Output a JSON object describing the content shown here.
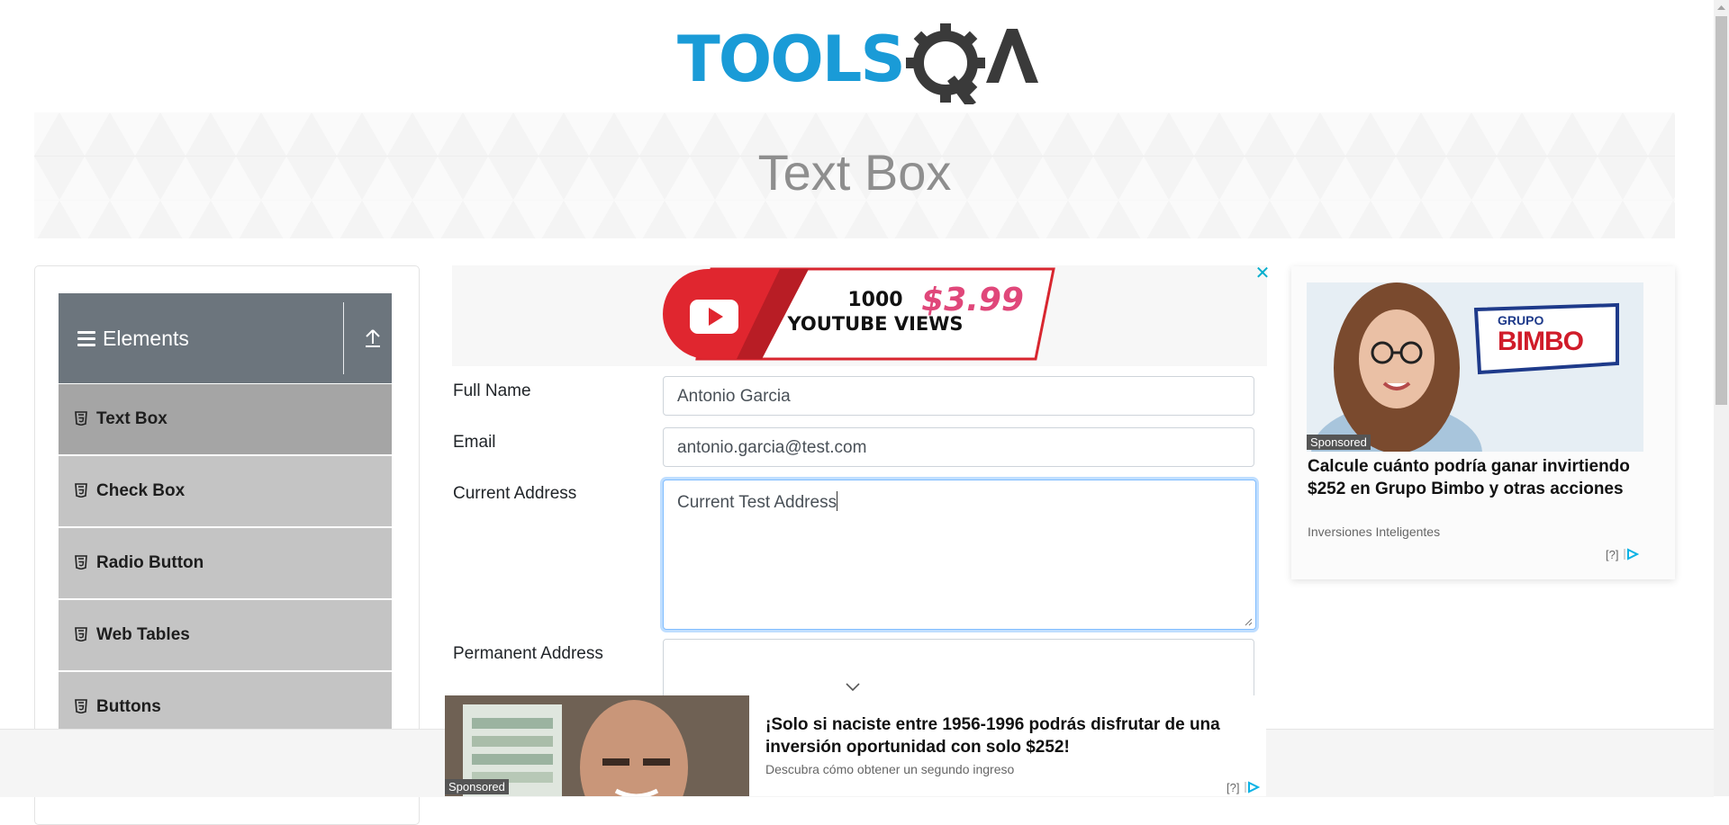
{
  "header": {
    "logo_text": "TOOLSQA",
    "brand_colors": {
      "tools": "#1a9bd7",
      "qa": "#3a3a3a"
    }
  },
  "banner": {
    "title": "Text Box"
  },
  "sidebar": {
    "group_title": "Elements",
    "items": [
      {
        "label": "Text Box",
        "active": true
      },
      {
        "label": "Check Box",
        "active": false
      },
      {
        "label": "Radio Button",
        "active": false
      },
      {
        "label": "Web Tables",
        "active": false
      },
      {
        "label": "Buttons",
        "active": false
      }
    ]
  },
  "top_ad": {
    "line1": "1000",
    "line2": "YOUTUBE VIEWS",
    "price": "$3.99",
    "close_label": "✕"
  },
  "form": {
    "full_name": {
      "label": "Full Name",
      "value": "Antonio Garcia"
    },
    "email": {
      "label": "Email",
      "value": "antonio.garcia@test.com"
    },
    "current_address": {
      "label": "Current Address",
      "value": "Current Test Address"
    },
    "permanent_address": {
      "label": "Permanent Address",
      "value": ""
    }
  },
  "right_ad": {
    "sponsored": "Sponsored",
    "brand_small": "GRUPO",
    "brand_big": "BIMBO",
    "headline": "Calcule cuánto podría ganar invirtiendo $252 en Grupo Bimbo y otras acciones",
    "source": "Inversiones Inteligentes",
    "adchoices": "[?]"
  },
  "bottom_ad": {
    "sponsored": "Sponsored",
    "headline": "¡Solo si naciste entre 1956-1996 podrás disfrutar de una inversión oportunidad con solo $252!",
    "sub": "Descubra cómo obtener un segundo ingreso",
    "adchoices": "[?]"
  }
}
